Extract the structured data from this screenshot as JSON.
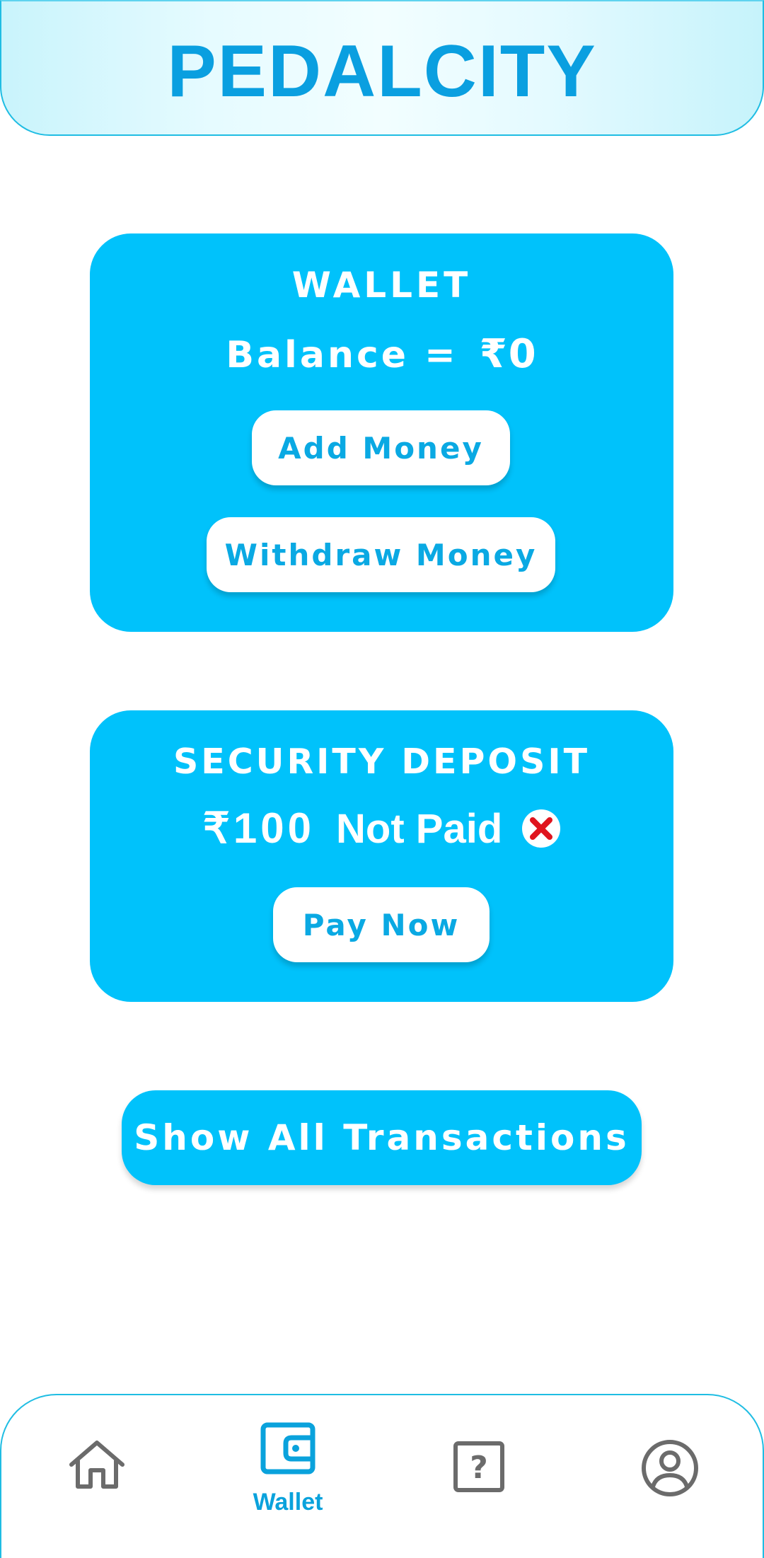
{
  "header": {
    "app_title": "PEDALCITY"
  },
  "wallet": {
    "title": "WALLET",
    "balance_label": "Balance =",
    "balance_amount": "₹0",
    "add_money_label": "Add Money",
    "withdraw_money_label": "Withdraw Money"
  },
  "security_deposit": {
    "title": "SECURITY DEPOSIT",
    "amount": "₹100",
    "status": "Not Paid",
    "status_icon": "close-circle-icon",
    "pay_now_label": "Pay Now"
  },
  "transactions": {
    "show_all_label": "Show All Transactions"
  },
  "bottom_nav": {
    "items": [
      {
        "icon": "home-icon",
        "label": "",
        "active": false
      },
      {
        "icon": "wallet-icon",
        "label": "Wallet",
        "active": true
      },
      {
        "icon": "help-icon",
        "label": "",
        "active": false
      },
      {
        "icon": "profile-icon",
        "label": "",
        "active": false
      }
    ]
  },
  "colors": {
    "accent": "#00c2fb",
    "title_blue": "#0a9fe0",
    "icon_gray": "#6b6b6b",
    "status_red": "#e0141e"
  }
}
